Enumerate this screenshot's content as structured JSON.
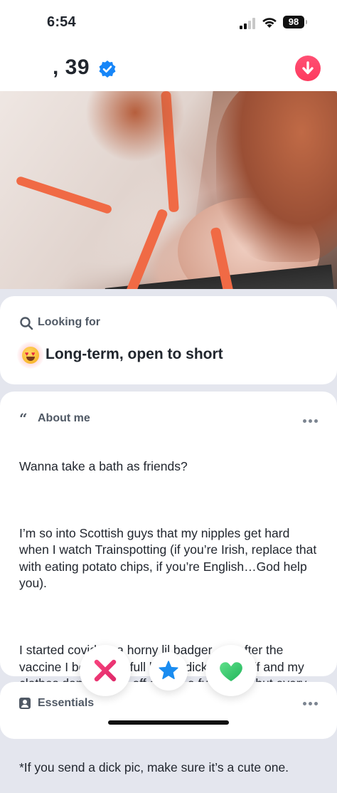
{
  "status_bar": {
    "time": "6:54",
    "battery": "98"
  },
  "profile": {
    "name_age": ", 39",
    "verified": true
  },
  "looking_for": {
    "label": "Looking for",
    "value": "Long-term, open to short",
    "emoji": "heart-eyes"
  },
  "about_me": {
    "label": "About me",
    "paragraph_1": "Wanna take a bath as friends?",
    "paragraph_2": "I’m so into Scottish guys that my nipples get hard when I watch Trainspotting (if you’re Irish, replace that with eating potato chips, if you’re English…God help you).",
    "paragraph_3a": "I started covid as a horny lil badger ",
    "paragraph_3b": " after the vaccine I became a full blown dick werewolf and my clothes don’t just rip off during a full moon, but every damn day.",
    "paragraph_4": "*If you send a dick pic, make sure it’s a cute one."
  },
  "essentials": {
    "label": "Essentials"
  },
  "colors": {
    "accent": "#fd3b5f",
    "verified_blue": "#1786f8",
    "nope_pink": "#e6337a",
    "superlike_blue": "#1a8cf0",
    "like_green": "#38c96a",
    "background": "#e4e6ee"
  },
  "icons": {
    "verified": "verified-badge-icon",
    "collapse": "arrow-down-icon",
    "search": "search-icon",
    "quote": "quote-icon",
    "more": "more-icon",
    "essentials": "essentials-icon",
    "nope": "x-icon",
    "superlike": "star-icon",
    "like": "heart-icon"
  }
}
